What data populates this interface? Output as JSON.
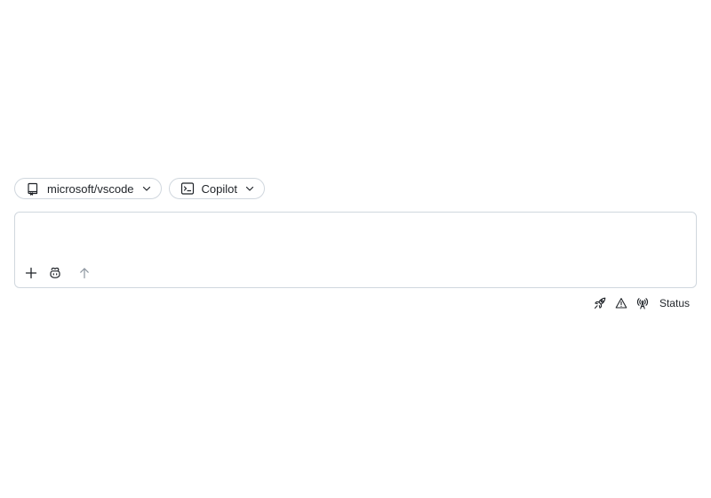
{
  "selectors": {
    "repository": {
      "label": "microsoft/vscode",
      "icon": "repo-icon"
    },
    "agent": {
      "label": "Copilot",
      "icon": "terminal-icon"
    }
  },
  "composer": {
    "value": "",
    "placeholder": "",
    "tools": [
      "add-icon",
      "copilot-icon",
      "send-arrow-icon"
    ]
  },
  "status_bar": {
    "icons": [
      "rocket-icon",
      "alert-icon",
      "broadcast-icon"
    ],
    "status_label": "Status"
  },
  "colors": {
    "border": "#d0d7de",
    "text": "#1f2328",
    "muted": "#8c959f"
  }
}
